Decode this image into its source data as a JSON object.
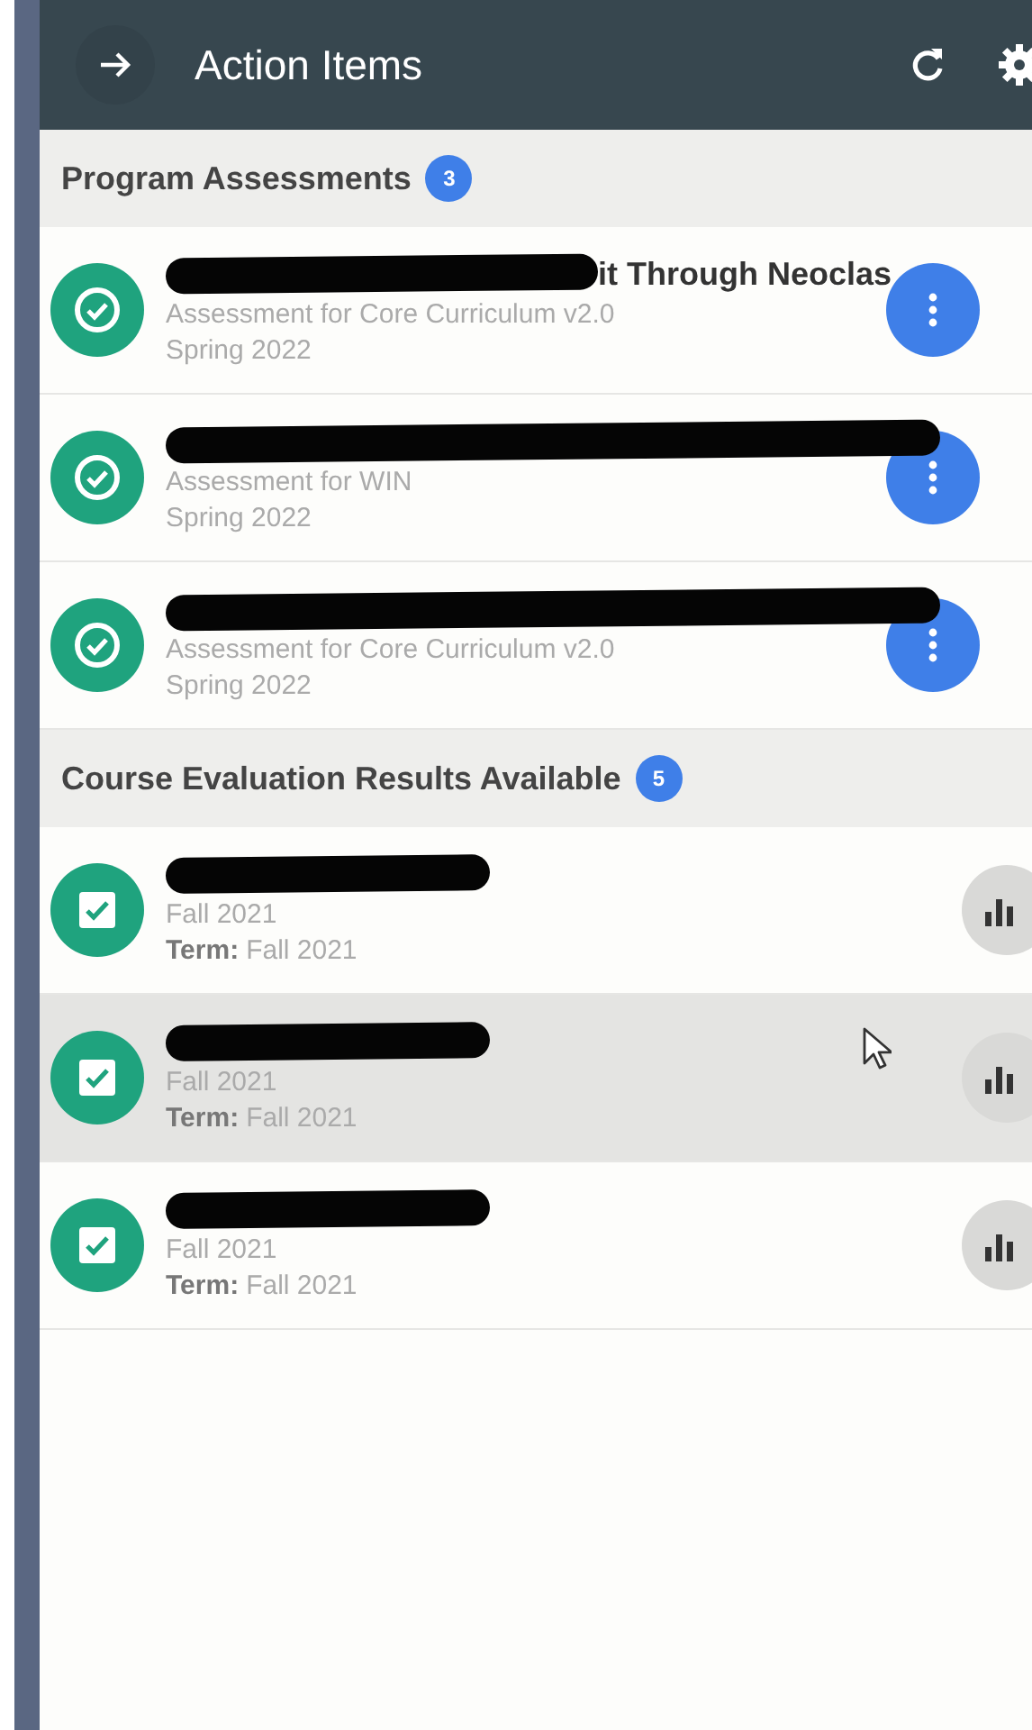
{
  "header": {
    "title": "Action Items"
  },
  "sections": [
    {
      "title": "Program Assessments",
      "count": "3",
      "kind": "assessment",
      "items": [
        {
          "redacted": true,
          "title": "it Through Neoclas",
          "subtitle": "Assessment for Core Curriculum v2.0",
          "term": "Spring 2022"
        },
        {
          "redacted": true,
          "subtitle": "Assessment for WIN",
          "term": "Spring 2022"
        },
        {
          "redacted": true,
          "subtitle": "Assessment for Core Curriculum v2.0",
          "term": "Spring 2022"
        }
      ]
    },
    {
      "title": "Course Evaluation Results Available",
      "count": "5",
      "kind": "evaluation",
      "items": [
        {
          "redacted": true,
          "hovered": false,
          "subtitle": "Fall 2021",
          "term_label": "Term:",
          "term": "Fall 2021"
        },
        {
          "redacted": true,
          "hovered": true,
          "subtitle": "Fall 2021",
          "term_label": "Term:",
          "term": "Fall 2021"
        },
        {
          "redacted": true,
          "hovered": false,
          "subtitle": "Fall 2021",
          "term_label": "Term:",
          "term": "Fall 2021"
        }
      ]
    }
  ]
}
